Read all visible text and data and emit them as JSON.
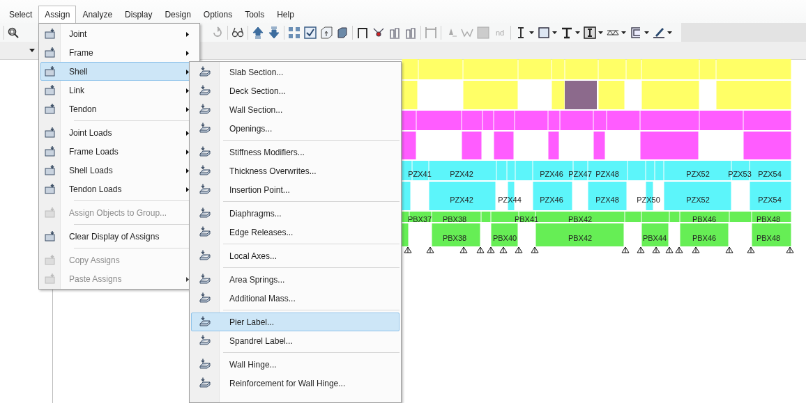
{
  "menu_bar": [
    {
      "label": "Select",
      "selected": false
    },
    {
      "label": "Assign",
      "selected": true
    },
    {
      "label": "Analyze",
      "selected": false
    },
    {
      "label": "Display",
      "selected": false
    },
    {
      "label": "Design",
      "selected": false
    },
    {
      "label": "Options",
      "selected": false
    },
    {
      "label": "Tools",
      "selected": false
    },
    {
      "label": "Help",
      "selected": false
    }
  ],
  "toolbar": {
    "text_button": "nd"
  },
  "assign_menu": [
    {
      "kind": "item",
      "label": "Joint",
      "submenu": true,
      "disabled": false,
      "selected": false
    },
    {
      "kind": "item",
      "label": "Frame",
      "submenu": true,
      "disabled": false,
      "selected": false
    },
    {
      "kind": "item",
      "label": "Shell",
      "submenu": true,
      "disabled": false,
      "selected": true
    },
    {
      "kind": "item",
      "label": "Link",
      "submenu": true,
      "disabled": false,
      "selected": false
    },
    {
      "kind": "item",
      "label": "Tendon",
      "submenu": true,
      "disabled": false,
      "selected": false
    },
    {
      "kind": "separator"
    },
    {
      "kind": "item",
      "label": "Joint Loads",
      "submenu": true,
      "disabled": false,
      "selected": false
    },
    {
      "kind": "item",
      "label": "Frame Loads",
      "submenu": true,
      "disabled": false,
      "selected": false
    },
    {
      "kind": "item",
      "label": "Shell Loads",
      "submenu": true,
      "disabled": false,
      "selected": false
    },
    {
      "kind": "item",
      "label": "Tendon Loads",
      "submenu": true,
      "disabled": false,
      "selected": false
    },
    {
      "kind": "separator"
    },
    {
      "kind": "item",
      "label": "Assign Objects to Group...",
      "submenu": false,
      "disabled": true,
      "selected": false
    },
    {
      "kind": "separator"
    },
    {
      "kind": "item",
      "label": "Clear Display of Assigns",
      "submenu": false,
      "disabled": false,
      "selected": false
    },
    {
      "kind": "separator"
    },
    {
      "kind": "item",
      "label": "Copy Assigns",
      "submenu": false,
      "disabled": true,
      "selected": false
    },
    {
      "kind": "item",
      "label": "Paste Assigns",
      "submenu": true,
      "disabled": true,
      "selected": false
    }
  ],
  "shell_submenu": [
    {
      "kind": "item",
      "label": "Slab Section...",
      "selected": false
    },
    {
      "kind": "item",
      "label": "Deck Section...",
      "selected": false
    },
    {
      "kind": "item",
      "label": "Wall Section...",
      "selected": false
    },
    {
      "kind": "item",
      "label": "Openings...",
      "selected": false
    },
    {
      "kind": "separator"
    },
    {
      "kind": "item",
      "label": "Stiffness Modifiers...",
      "selected": false
    },
    {
      "kind": "item",
      "label": "Thickness Overwrites...",
      "selected": false
    },
    {
      "kind": "item",
      "label": "Insertion Point...",
      "selected": false
    },
    {
      "kind": "separator"
    },
    {
      "kind": "item",
      "label": "Diaphragms...",
      "selected": false
    },
    {
      "kind": "item",
      "label": "Edge Releases...",
      "selected": false
    },
    {
      "kind": "separator"
    },
    {
      "kind": "item",
      "label": "Local Axes...",
      "selected": false
    },
    {
      "kind": "separator"
    },
    {
      "kind": "item",
      "label": "Area Springs...",
      "selected": false
    },
    {
      "kind": "item",
      "label": "Additional Mass...",
      "selected": false
    },
    {
      "kind": "separator"
    },
    {
      "kind": "item",
      "label": "Pier Label...",
      "selected": true
    },
    {
      "kind": "item",
      "label": "Spandrel Label...",
      "selected": false
    },
    {
      "kind": "separator"
    },
    {
      "kind": "item",
      "label": "Wall Hinge...",
      "selected": false
    },
    {
      "kind": "item",
      "label": "Reinforcement for Wall Hinge...",
      "selected": false
    }
  ],
  "model_view": {
    "pier_labels_upper": [
      "PZX41",
      "PZX42",
      "PZX46",
      "PZX47",
      "PZX48",
      "PZX52",
      "PZX53",
      "PZX54"
    ],
    "pier_labels_lower": [
      "PZX42",
      "PZX44",
      "PZX46",
      "PZX48",
      "PZX50",
      "PZX52",
      "PZX54"
    ],
    "spandrel_labels_upper": [
      "PBX37",
      "PBX38",
      "PBX41",
      "PBX42",
      "PBX46",
      "PBX48"
    ],
    "spandrel_labels_lower": [
      "PBX38",
      "PBX40",
      "PBX42",
      "PBX44",
      "PBX46",
      "PBX48"
    ]
  }
}
